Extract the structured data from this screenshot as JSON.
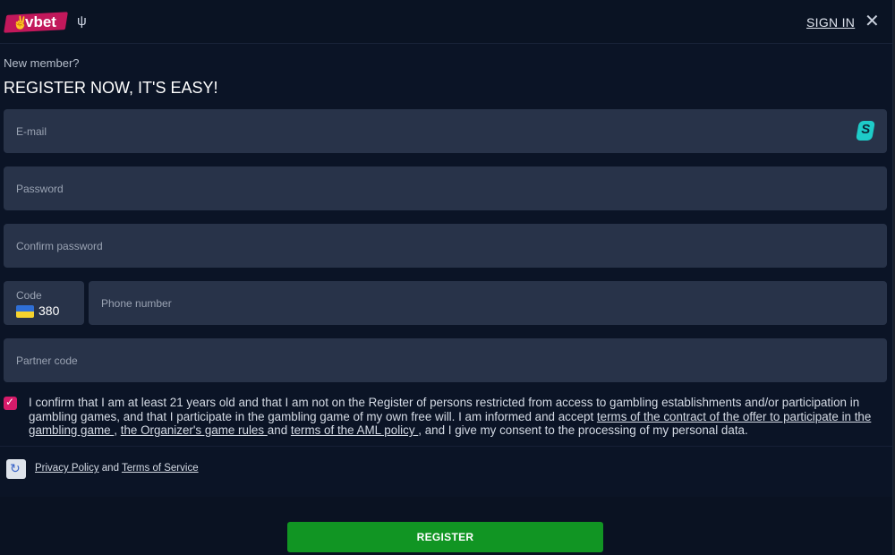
{
  "header": {
    "logo_text": "vbet",
    "sign_in_label": "SIGN IN",
    "close_symbol": "✕"
  },
  "form": {
    "subtitle": "New member?",
    "title": "REGISTER NOW, IT'S EASY!",
    "email_placeholder": "E-mail",
    "password_placeholder": "Password",
    "confirm_password_placeholder": "Confirm password",
    "code_label": "Code",
    "code_value": "380",
    "phone_placeholder": "Phone number",
    "partner_placeholder": "Partner code"
  },
  "consent": {
    "checked": true,
    "text_1": "I confirm that I am at least 21 years old and that I am not on the Register of persons restricted from access to gambling establishments and/or participation in gambling games, and that I participate in the gambling game of my own free will. I am informed and accept ",
    "link_1": "terms of the contract of the offer to participate in the gambling game ",
    "sep_1": ", ",
    "link_2": "the Organizer's game rules ",
    "sep_2": "and ",
    "link_3": "terms of the AML policy ",
    "text_2": ", and I give my consent to the processing of my personal data."
  },
  "recaptcha": {
    "privacy_label": "Privacy Policy",
    "and_label": " and ",
    "terms_label": "Terms of Service"
  },
  "register_label": "REGISTER",
  "colors": {
    "background": "#0b1426",
    "field": "#283349",
    "accent_pink": "#d61b6a",
    "register_green": "#119523"
  },
  "icons": {
    "close": "close-icon",
    "surfshark": "surfshark-extension-icon",
    "recaptcha": "recaptcha-icon",
    "trident": "trident-icon",
    "flag": "ukraine-flag-icon"
  }
}
